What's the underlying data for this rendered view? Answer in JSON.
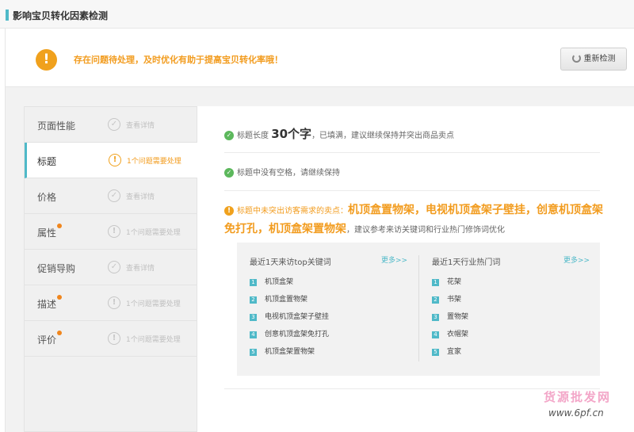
{
  "header": {
    "title": "影响宝贝转化因素检测"
  },
  "alert": {
    "icon": "exclamation-icon",
    "message": "存在问题待处理，及时优化有助于提高宝贝转化率哦！",
    "button_label": "重新检测"
  },
  "colors": {
    "accent": "#4fb9c8",
    "warning": "#f29c1f",
    "ok": "#5cb85c"
  },
  "sidebar": {
    "items": [
      {
        "label": "页面性能",
        "status": "查看详情",
        "state": "ok"
      },
      {
        "label": "标题",
        "status": "1个问题需要处理",
        "state": "warn",
        "active": true
      },
      {
        "label": "价格",
        "status": "查看详情",
        "state": "ok"
      },
      {
        "label": "属性",
        "status": "1个问题需要处理",
        "state": "warn",
        "dot": true
      },
      {
        "label": "促销导购",
        "status": "查看详情",
        "state": "ok"
      },
      {
        "label": "描述",
        "status": "1个问题需要处理",
        "state": "warn",
        "dot": true
      },
      {
        "label": "评价",
        "status": "1个问题需要处理",
        "state": "warn",
        "dot": true
      }
    ]
  },
  "main": {
    "check1": {
      "pre": "标题长度",
      "num": "30个字",
      "post": "，已填满，建议继续保持并突出商品卖点"
    },
    "check2": {
      "text": "标题中没有空格，请继续保持"
    },
    "warning": {
      "pre": "标题中未突出访客需求的卖点：",
      "keywords": "机顶盒置物架，电视机顶盒架子壁挂，创意机顶盒架免打孔，机顶盒架置物架",
      "post": "，建议参考来访关键词和行业热门修饰词优化"
    },
    "visitor_keywords": {
      "title": "最近1天来访top关键词",
      "more": "更多>>",
      "items": [
        "机顶盒架",
        "机顶盒置物架",
        "电视机顶盒架子壁挂",
        "创意机顶盒架免打孔",
        "机顶盒架置物架"
      ]
    },
    "industry_words": {
      "title": "最近1天行业热门词",
      "more": "更多>>",
      "items": [
        "花架",
        "书架",
        "置物架",
        "衣帽架",
        "宜家"
      ]
    }
  },
  "watermark": {
    "top": "货源批发网",
    "bottom": "www.6pf.cn"
  }
}
